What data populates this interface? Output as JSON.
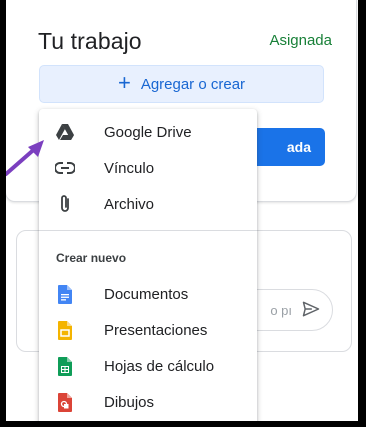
{
  "work": {
    "title": "Tu trabajo",
    "status": "Asignada",
    "add_button_label": "Agregar o crear",
    "submit_partial_label": "ada"
  },
  "comment": {
    "input_partial_placeholder": "o pı"
  },
  "menu": {
    "items": [
      {
        "label": "Google Drive",
        "icon": "google-drive-icon"
      },
      {
        "label": "Vínculo",
        "icon": "link-icon"
      },
      {
        "label": "Archivo",
        "icon": "paperclip-icon"
      }
    ],
    "section_title": "Crear nuevo",
    "create_items": [
      {
        "label": "Documentos",
        "icon": "docs-icon",
        "color": "#4285f4"
      },
      {
        "label": "Presentaciones",
        "icon": "slides-icon",
        "color": "#f4b400"
      },
      {
        "label": "Hojas de cálculo",
        "icon": "sheets-icon",
        "color": "#0f9d58"
      },
      {
        "label": "Dibujos",
        "icon": "drawings-icon",
        "color": "#db4437"
      }
    ]
  },
  "colors": {
    "status_green": "#188038",
    "primary_blue": "#1a73e8",
    "annotation_arrow": "#7b3fbf"
  }
}
